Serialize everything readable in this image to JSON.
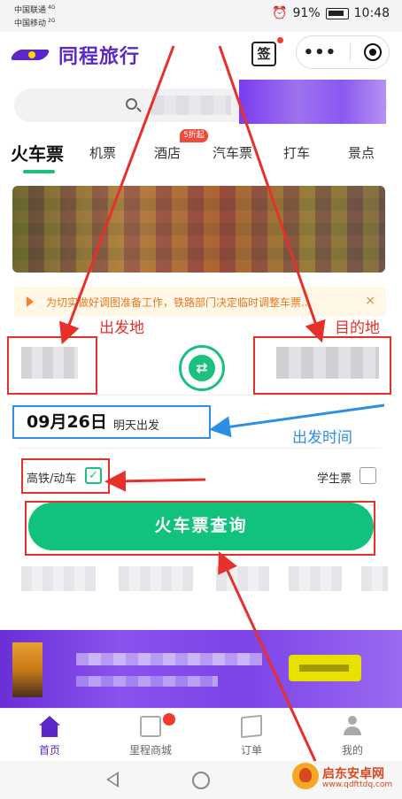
{
  "status_bar": {
    "carrier_1": "中国联通",
    "carrier_1_net": "4G",
    "carrier_2": "中国移动",
    "carrier_2_net": "2G",
    "battery_level": "91%",
    "time": "10:48"
  },
  "header": {
    "app_name": "同程旅行",
    "sign_label": "签",
    "more_label": "•••"
  },
  "tabs": [
    {
      "label": "火车票",
      "active": true
    },
    {
      "label": "机票"
    },
    {
      "label": "酒店",
      "badge": "5折起"
    },
    {
      "label": "汽车票"
    },
    {
      "label": "打车"
    },
    {
      "label": "景点"
    }
  ],
  "notice": {
    "text": "为切实做好调图准备工作，铁路部门决定临时调整车票...",
    "close": "×"
  },
  "search_form": {
    "date": "09月26日",
    "date_hint": "明天出发",
    "high_speed_label": "高铁/动车",
    "high_speed_checked": true,
    "student_label": "学生票",
    "student_checked": false,
    "query_button": "火车票查询"
  },
  "bottom_nav": [
    {
      "label": "首页",
      "icon": "home-icon",
      "active": true
    },
    {
      "label": "里程商城",
      "icon": "bag-icon"
    },
    {
      "label": "订单",
      "icon": "order-icon"
    },
    {
      "label": "我的",
      "icon": "user-icon"
    }
  ],
  "annotations": {
    "from": "出发地",
    "to": "目的地",
    "time": "出发时间"
  },
  "watermark": {
    "name": "启东安卓网",
    "url": "www.qdfttdq.com"
  },
  "colors": {
    "brand": "#5b27c9",
    "accent_green": "#10c27c",
    "annotation_red": "#e8302a",
    "annotation_blue": "#2c8fe6"
  }
}
